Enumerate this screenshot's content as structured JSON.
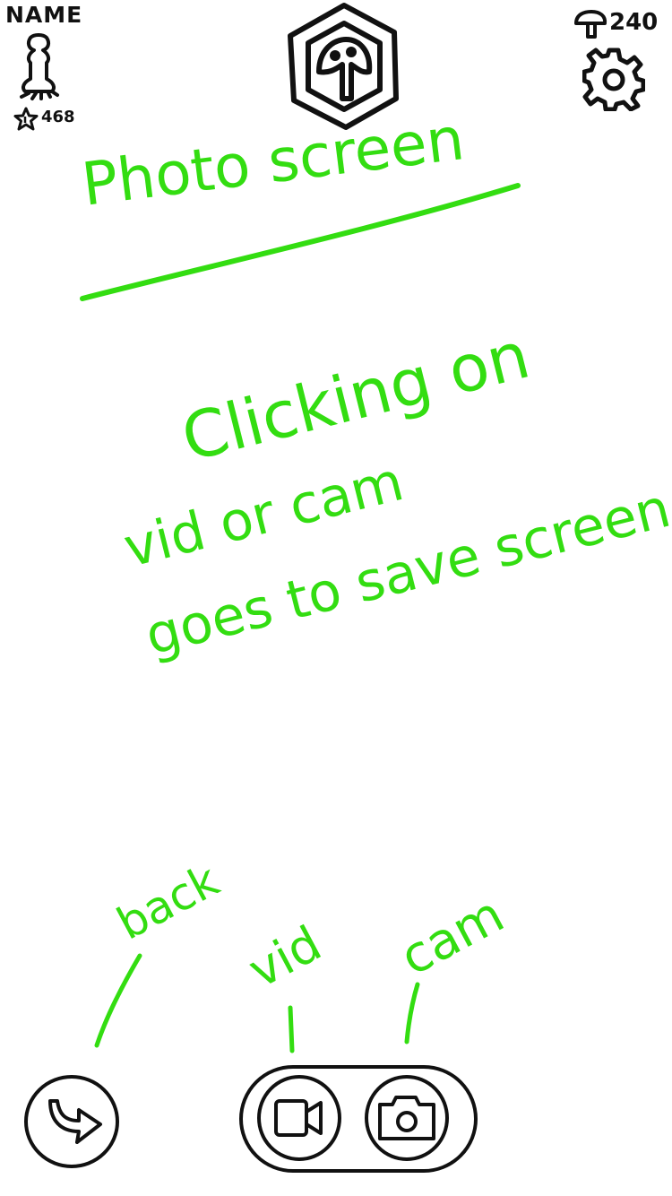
{
  "profile": {
    "name": "NAME",
    "stars": "468"
  },
  "currency": {
    "mushrooms": "240"
  },
  "annotations": {
    "title": "Photo screen",
    "body_line_1": "Clicking on",
    "body_line_2": "vid or cam",
    "body_line_3": "goes to save screen",
    "label_back": "back",
    "label_vid": "vid",
    "label_cam": "cam"
  },
  "icons": {
    "avatar": "pawn-avatar-icon",
    "star": "star-icon",
    "mushroom": "mushroom-icon",
    "settings": "gear-icon",
    "logo": "mushroom-hexagon-logo",
    "back": "back-arrow-icon",
    "video": "video-camera-icon",
    "camera": "photo-camera-icon"
  },
  "colors": {
    "ink": "#111111",
    "annotation": "#33dd11",
    "background": "#ffffff"
  }
}
